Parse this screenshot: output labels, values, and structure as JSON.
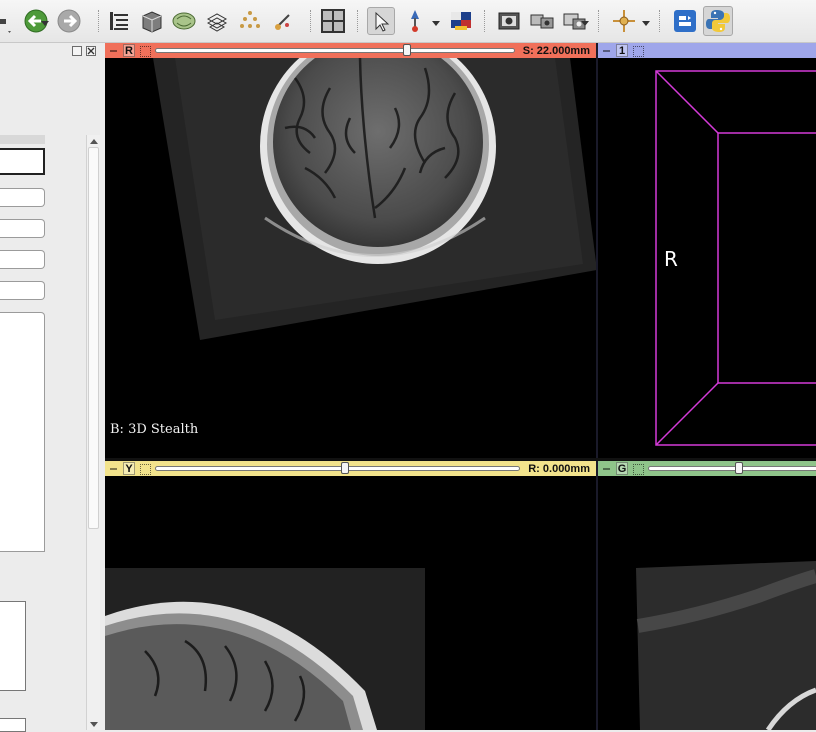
{
  "views": {
    "red": {
      "letter": "R",
      "offset": "S: 22.000mm",
      "slider_value": 0.7,
      "bar_color": "#f0705a",
      "annotation": "B: 3D Stealth"
    },
    "threed": {
      "letter": "1",
      "bar_color": "#9fa6ea",
      "orientation_label": "R",
      "box_color": "#d43ad8"
    },
    "yellow": {
      "letter": "Y",
      "offset": "R: 0.000mm",
      "slider_value": 0.52,
      "bar_color": "#f2e38c"
    },
    "green": {
      "letter": "G",
      "slider_value": 0.4,
      "bar_color": "#8fc48a"
    }
  },
  "toolbar": {
    "icons": [
      "menu-icon",
      "back-icon",
      "forward-icon",
      "data-icon",
      "volumes-icon",
      "models-icon",
      "transforms-icon",
      "markups-icon",
      "editor-icon",
      "layout-icon",
      "select-icon",
      "place-icon",
      "window-level-icon",
      "screenshot-icon",
      "scene-view-icon",
      "capture-icon",
      "crosshair-icon",
      "extension-icon",
      "python-icon"
    ]
  }
}
